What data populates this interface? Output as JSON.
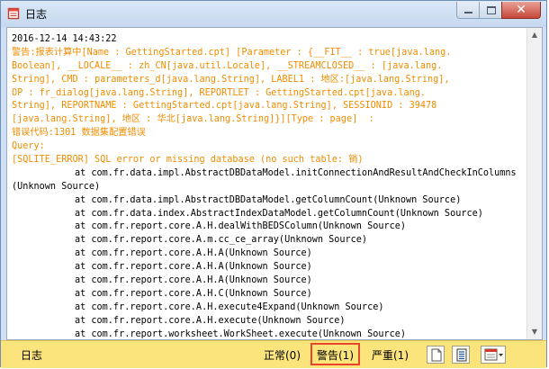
{
  "window": {
    "title": "日志",
    "close_glyph": "✕"
  },
  "log": {
    "lines": [
      {
        "text": "2016-12-14 14:43:22",
        "style": "black",
        "indent": false
      },
      {
        "text": "警告:报表计算中[Name : GettingStarted.cpt] [Parameter : {__FIT__ : true[java.lang.",
        "style": "warn",
        "indent": false
      },
      {
        "text": "Boolean], __LOCALE__ : zh_CN[java.util.Locale], __STREAMCLOSED__ : [java.lang.",
        "style": "warn",
        "indent": false
      },
      {
        "text": "String], CMD : parameters_d[java.lang.String], LABEL1 : 地区:[java.lang.String],",
        "style": "warn",
        "indent": false
      },
      {
        "text": "OP : fr_dialog[java.lang.String], REPORTLET : GettingStarted.cpt[java.lang.",
        "style": "warn",
        "indent": false
      },
      {
        "text": "String], REPORTNAME : GettingStarted.cpt[java.lang.String], SESSIONID : 39478",
        "style": "warn",
        "indent": false
      },
      {
        "text": "[java.lang.String], 地区 : 华北[java.lang.String]}][Type : page]  :",
        "style": "warn",
        "indent": false
      },
      {
        "text": "错误代码:1301 数据集配置错误",
        "style": "warn",
        "indent": false
      },
      {
        "text": "Query:",
        "style": "warn",
        "indent": false
      },
      {
        "text": "[SQLITE_ERROR] SQL error or missing database (no such table: 销)",
        "style": "warn",
        "indent": false
      },
      {
        "text": "at com.fr.data.impl.AbstractDBDataModel.initConnectionAndResultAndCheckInColumns",
        "style": "black",
        "indent": true
      },
      {
        "text": "(Unknown Source)",
        "style": "black",
        "indent": false
      },
      {
        "text": "at com.fr.data.impl.AbstractDBDataModel.getColumnCount(Unknown Source)",
        "style": "black",
        "indent": true
      },
      {
        "text": "at com.fr.data.index.AbstractIndexDataModel.getColumnCount(Unknown Source)",
        "style": "black",
        "indent": true
      },
      {
        "text": "at com.fr.report.core.A.H.dealWithBEDSColumn(Unknown Source)",
        "style": "black",
        "indent": true
      },
      {
        "text": "at com.fr.report.core.A.m.cc_ce_array(Unknown Source)",
        "style": "black",
        "indent": true
      },
      {
        "text": "at com.fr.report.core.A.H.A(Unknown Source)",
        "style": "black",
        "indent": true
      },
      {
        "text": "at com.fr.report.core.A.H.A(Unknown Source)",
        "style": "black",
        "indent": true
      },
      {
        "text": "at com.fr.report.core.A.H.A(Unknown Source)",
        "style": "black",
        "indent": true
      },
      {
        "text": "at com.fr.report.core.A.H.C(Unknown Source)",
        "style": "black",
        "indent": true
      },
      {
        "text": "at com.fr.report.core.A.H.execute4Expand(Unknown Source)",
        "style": "black",
        "indent": true
      },
      {
        "text": "at com.fr.report.core.A.H.execute(Unknown Source)",
        "style": "black",
        "indent": true
      },
      {
        "text": "at com.fr.report.worksheet.WorkSheet.execute(Unknown Source)",
        "style": "black",
        "indent": true
      }
    ]
  },
  "status": {
    "label": "日志",
    "filter_normal": "正常(0)",
    "filter_warning": "警告(1)",
    "filter_severe": "严重(1)"
  },
  "colors": {
    "warning_text": "#f08c00",
    "statusbar_bg": "#fbe47c",
    "highlight_border": "#e8462c"
  },
  "icons": [
    "app-log-icon",
    "minimize-icon",
    "maximize-icon",
    "close-icon",
    "clear-log-icon",
    "export-log-icon",
    "log-options-icon",
    "scroll-up-arrow-icon",
    "scroll-down-arrow-icon"
  ]
}
